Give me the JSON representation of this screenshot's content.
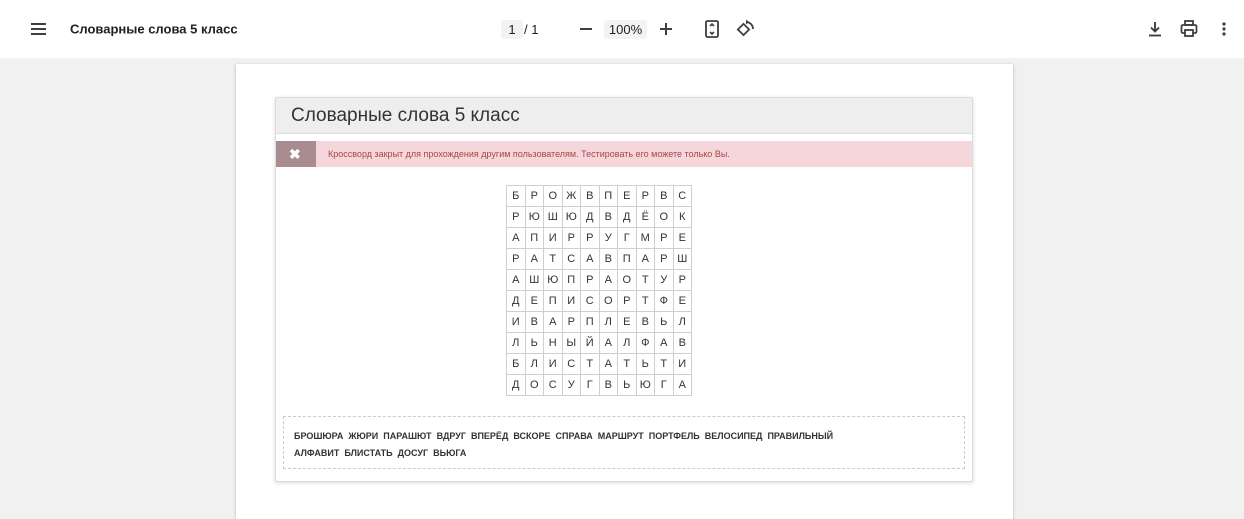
{
  "toolbar": {
    "title": "Словарные слова 5 класс",
    "page_current": "1",
    "page_total": "/ 1",
    "zoom": "100%",
    "icons": [
      "menu-icon",
      "zoom-out-icon",
      "zoom-in-icon",
      "fit-page-icon",
      "rotate-icon",
      "download-icon",
      "print-icon",
      "more-vert-icon"
    ]
  },
  "document": {
    "title": "Словарные слова 5 класс",
    "alert": {
      "icon": "close-icon",
      "text": "Кроссворд закрыт для прохождения другим пользователям. Тестировать его можете только Вы."
    },
    "grid": [
      [
        "Б",
        "Р",
        "О",
        "Ж",
        "В",
        "П",
        "Е",
        "Р",
        "В",
        "С"
      ],
      [
        "Р",
        "Ю",
        "Ш",
        "Ю",
        "Д",
        "В",
        "Д",
        "Ё",
        "О",
        "К"
      ],
      [
        "А",
        "П",
        "И",
        "Р",
        "Р",
        "У",
        "Г",
        "М",
        "Р",
        "Е"
      ],
      [
        "Р",
        "А",
        "Т",
        "С",
        "А",
        "В",
        "П",
        "А",
        "Р",
        "Ш"
      ],
      [
        "А",
        "Ш",
        "Ю",
        "П",
        "Р",
        "А",
        "О",
        "Т",
        "У",
        "Р"
      ],
      [
        "Д",
        "Е",
        "П",
        "И",
        "С",
        "О",
        "Р",
        "Т",
        "Ф",
        "Е"
      ],
      [
        "И",
        "В",
        "А",
        "Р",
        "П",
        "Л",
        "Е",
        "В",
        "Ь",
        "Л"
      ],
      [
        "Л",
        "Ь",
        "Н",
        "Ы",
        "Й",
        "А",
        "Л",
        "Ф",
        "А",
        "В"
      ],
      [
        "Б",
        "Л",
        "И",
        "С",
        "Т",
        "А",
        "Т",
        "Ь",
        "Т",
        "И"
      ],
      [
        "Д",
        "О",
        "С",
        "У",
        "Г",
        "В",
        "Ь",
        "Ю",
        "Г",
        "А"
      ]
    ],
    "words_lines": [
      [
        "БРОШЮРА",
        "ЖЮРИ",
        "ПАРАШЮТ",
        "ВДРУГ",
        "ВПЕРЁД",
        "ВСКОРЕ",
        "СПРАВА",
        "МАРШРУТ",
        "ПОРТФЕЛЬ",
        "ВЕЛОСИПЕД",
        "ПРАВИЛЬНЫЙ"
      ],
      [
        "АЛФАВИТ",
        "БЛИСТАТЬ",
        "ДОСУГ",
        "ВЬЮГА"
      ]
    ]
  },
  "colors": {
    "viewer_bg": "#f1f1f1",
    "alert_bg": "#f5d7db",
    "alert_text": "#a94442",
    "alert_icon_bg": "#a98c90",
    "header_bg": "#eeeeee"
  }
}
